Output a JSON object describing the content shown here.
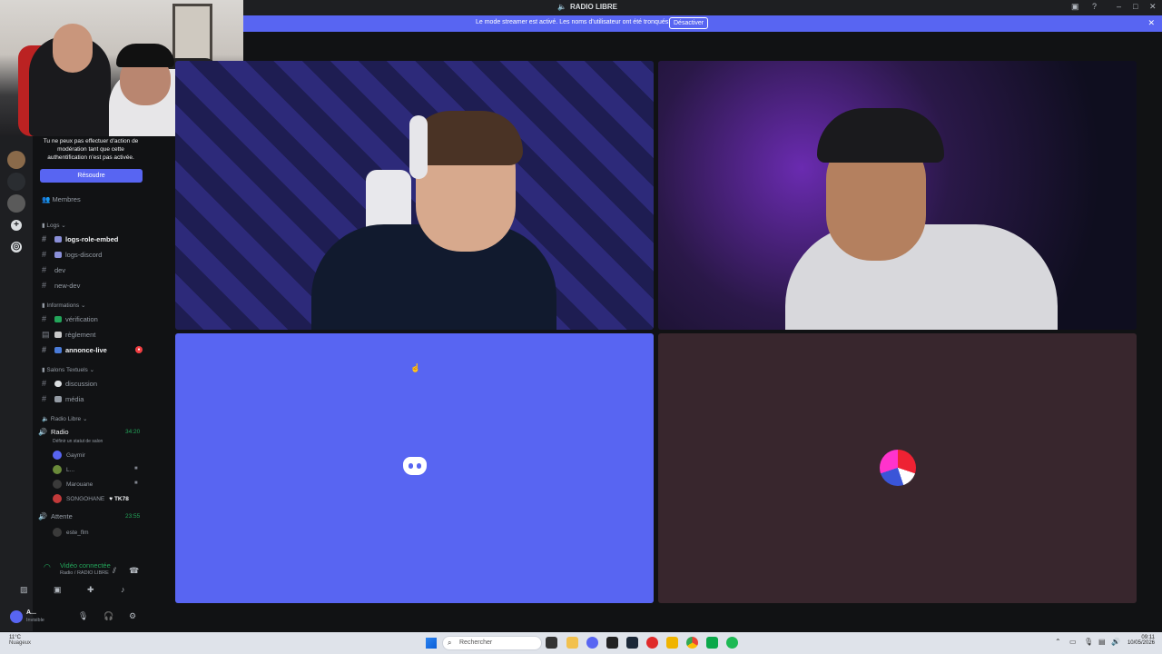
{
  "window": {
    "title": "RADIO LIBRE",
    "controls": [
      "minimize",
      "maximize",
      "close"
    ]
  },
  "banner": {
    "message": "Le mode streamer est activé. Les noms d'utilisateur ont été tronqués.",
    "button": "Désactiver"
  },
  "sidebar": {
    "auth_message": "Tu ne peux pas effectuer d'action de modération tant que cette authentification n'est pas activée.",
    "resolve_button": "Résoudre",
    "members": "Membres",
    "categories": {
      "logs": "Logs",
      "informations": "Informations",
      "salons": "Salons Textuels",
      "radio": "Radio Libre"
    },
    "channels": {
      "logs_role_embed": "logs-role-embed",
      "logs_discord": "logs-discord",
      "dev": "dev",
      "new_dev": "new-dev",
      "verification": "vérification",
      "reglement": "règlement",
      "annonce_live": "annonce-live",
      "discussion": "discussion",
      "media": "média"
    },
    "voice": {
      "radio_name": "Radio",
      "radio_time": "34:20",
      "radio_status": "Définir un statut de salon",
      "radio_users": [
        "Gaymir",
        "L...",
        "Marouane",
        "SONGOHANE"
      ],
      "songohane_tag": "TK78",
      "attente_name": "Attente",
      "attente_time": "23:55",
      "attente_users": [
        "este_flm"
      ]
    },
    "voice_connected": {
      "title": "Vidéo connectée",
      "subtitle": "Radio / RADIO LIBRE"
    },
    "user": {
      "name": "A...",
      "status": "Invisible"
    }
  },
  "taskbar": {
    "temperature": "11°C",
    "weather": "Nuageux",
    "search_placeholder": "Rechercher",
    "time": "09:11",
    "date": "10/05/2026"
  },
  "colors": {
    "blurple": "#5865f2",
    "online_green": "#23a55a",
    "danger": "#f23f43",
    "tile_dark": "#38262d"
  }
}
